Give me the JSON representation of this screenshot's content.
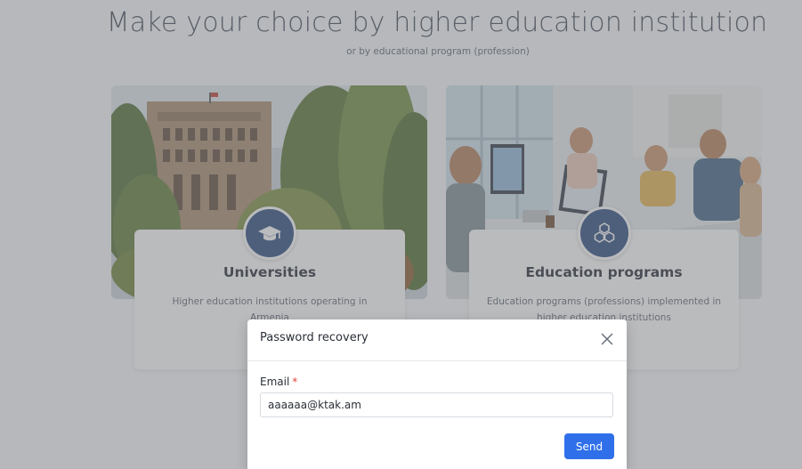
{
  "hero": {
    "title": "Make your choice by higher education institution",
    "subtitle": "or by educational program (profession)"
  },
  "cards": [
    {
      "title": "Universities",
      "description": "Higher education institutions operating in Armenia",
      "icon": "graduation-cap-icon"
    },
    {
      "title": "Education programs",
      "description": "Education programs (professions) implemented in higher education institutions",
      "icon": "cubes-icon"
    }
  ],
  "modal": {
    "title": "Password recovery",
    "email_label": "Email",
    "required_marker": "*",
    "email_value": "aaaaaa@ktak.am",
    "send_label": "Send",
    "close_icon": "close-icon"
  },
  "colors": {
    "badge": "#24467a",
    "primary_button": "#2f6fea",
    "required": "#e0423a",
    "overlay": "rgba(118,120,124,0.5)"
  }
}
